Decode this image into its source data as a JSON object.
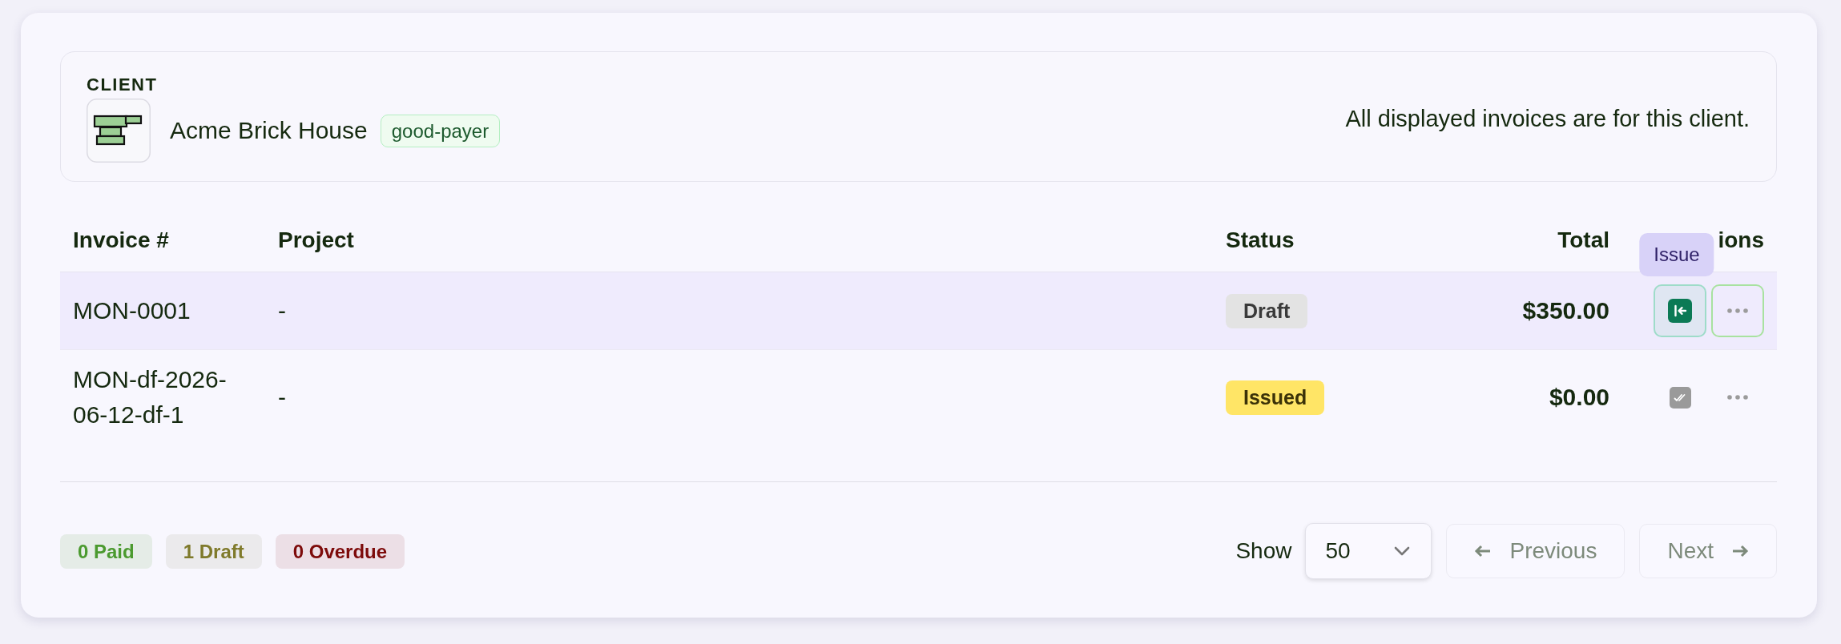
{
  "client": {
    "heading": "CLIENT",
    "name": "Acme Brick House",
    "tag": "good-payer",
    "note": "All displayed invoices are for this client."
  },
  "table": {
    "columns": [
      {
        "label": "Invoice #",
        "kind": "text"
      },
      {
        "label": "Project",
        "kind": "text"
      },
      {
        "label": "Status",
        "kind": "text"
      },
      {
        "label": "Total",
        "kind": "amount"
      },
      {
        "label": "ions",
        "kind": "amount"
      }
    ],
    "rows": [
      {
        "invoice_number": "MON-0001",
        "project": "-",
        "status": {
          "label": "Draft",
          "kind": "draft"
        },
        "total": "$350.00",
        "highlighted": true,
        "actions": [
          {
            "kind": "issue",
            "tooltip": "Issue"
          },
          {
            "kind": "more"
          }
        ]
      },
      {
        "invoice_number": "MON-df-2026-06-12-df-1",
        "project": "-",
        "status": {
          "label": "Issued",
          "kind": "issued"
        },
        "total": "$0.00",
        "highlighted": false,
        "actions": [
          {
            "kind": "check"
          },
          {
            "kind": "more"
          }
        ]
      }
    ]
  },
  "summary": [
    {
      "label": "0 Paid",
      "kind": "paid"
    },
    {
      "label": "1 Draft",
      "kind": "draft"
    },
    {
      "label": "0 Overdue",
      "kind": "overdue"
    }
  ],
  "pagination": {
    "show_label": "Show",
    "page_size": "50",
    "previous": {
      "label": "Previous",
      "disabled": true
    },
    "next": {
      "label": "Next",
      "disabled": true
    }
  }
}
